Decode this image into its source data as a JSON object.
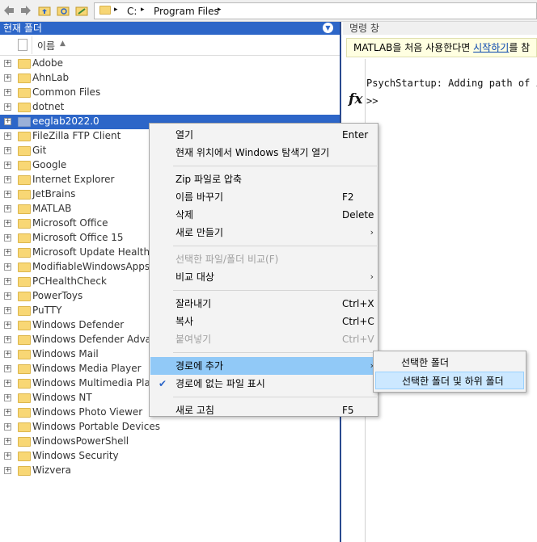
{
  "toolbar": {
    "back_icon": "back-arrow-icon",
    "forward_icon": "forward-arrow-icon",
    "path_segments": [
      "C:",
      "Program Files"
    ],
    "path_sep": "▸"
  },
  "left_panel": {
    "title": "현재 폴더",
    "column_name": "이름",
    "rows": [
      {
        "label": "Adobe"
      },
      {
        "label": "AhnLab"
      },
      {
        "label": "Common Files"
      },
      {
        "label": "dotnet"
      },
      {
        "label": "eeglab2022.0",
        "selected": true
      },
      {
        "label": "FileZilla FTP Client"
      },
      {
        "label": "Git"
      },
      {
        "label": "Google"
      },
      {
        "label": "Internet Explorer"
      },
      {
        "label": "JetBrains"
      },
      {
        "label": "MATLAB"
      },
      {
        "label": "Microsoft Office"
      },
      {
        "label": "Microsoft Office 15"
      },
      {
        "label": "Microsoft Update Health Tools"
      },
      {
        "label": "ModifiableWindowsApps"
      },
      {
        "label": "PCHealthCheck"
      },
      {
        "label": "PowerToys"
      },
      {
        "label": "PuTTY"
      },
      {
        "label": "Windows Defender"
      },
      {
        "label": "Windows Defender Advanced Threat Protection"
      },
      {
        "label": "Windows Mail"
      },
      {
        "label": "Windows Media Player"
      },
      {
        "label": "Windows Multimedia Platform"
      },
      {
        "label": "Windows NT"
      },
      {
        "label": "Windows Photo Viewer"
      },
      {
        "label": "Windows Portable Devices"
      },
      {
        "label": "WindowsPowerShell"
      },
      {
        "label": "Windows Security"
      },
      {
        "label": "Wizvera"
      }
    ]
  },
  "right_panel": {
    "title": "명령 창",
    "banner_text": "MATLAB을 처음 사용한다면 ",
    "banner_link": "시작하기",
    "banner_tail": "를 참",
    "line1": "PsychStartup: Adding path of i",
    "prompt": ">>",
    "fx": "fx"
  },
  "context_menu": {
    "items": [
      {
        "label": "열기",
        "key": "Enter"
      },
      {
        "label": "현재 위치에서 Windows 탐색기 열기",
        "key": ""
      },
      {
        "sep": true
      },
      {
        "label": "Zip 파일로 압축",
        "key": ""
      },
      {
        "label": "이름 바꾸기",
        "key": "F2"
      },
      {
        "label": "삭제",
        "key": "Delete"
      },
      {
        "label": "새로 만들기",
        "key": "",
        "submenu": true
      },
      {
        "sep": true
      },
      {
        "label": "선택한 파일/폴더 비교(F)",
        "key": "",
        "disabled": true
      },
      {
        "label": "비교 대상",
        "key": "",
        "submenu": true
      },
      {
        "sep": true
      },
      {
        "label": "잘라내기",
        "key": "Ctrl+X"
      },
      {
        "label": "복사",
        "key": "Ctrl+C"
      },
      {
        "label": "붙여넣기",
        "key": "Ctrl+V",
        "disabled": true
      },
      {
        "sep": true
      },
      {
        "label": "경로에 추가",
        "key": "",
        "submenu": true,
        "highlighted": true
      },
      {
        "label": "경로에 없는 파일 표시",
        "key": "",
        "checked": true
      },
      {
        "sep": true
      },
      {
        "label": "새로 고침",
        "key": "F5"
      }
    ],
    "submenu_arrow": "›",
    "check_mark": "✔"
  },
  "submenu": {
    "items": [
      {
        "label": "선택한 폴더"
      },
      {
        "label": "선택한 폴더 및 하위 폴더",
        "highlighted": true
      }
    ]
  }
}
